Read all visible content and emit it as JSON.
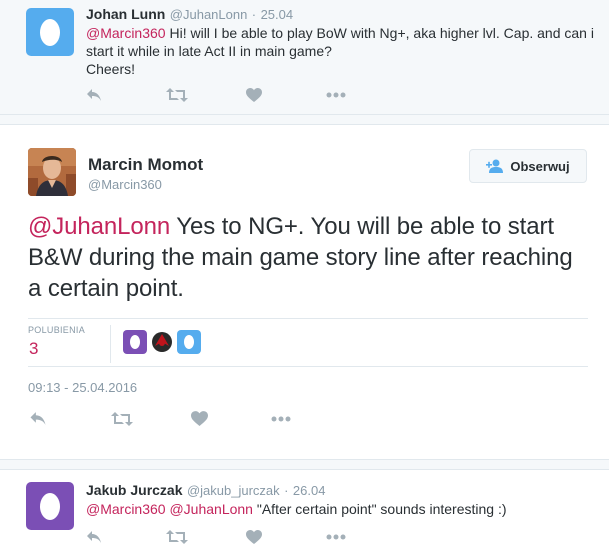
{
  "colors": {
    "accent": "#c4245c",
    "egg_blue": "#55acee",
    "egg_purple": "#7b4fb5",
    "muted": "#8899a6",
    "text": "#292f33"
  },
  "tweets": [
    {
      "name": "Johan Lunn",
      "handle": "@JuhanLonn",
      "separator": "·",
      "date": "25.04",
      "mention": "@Marcin360",
      "body": " Hi! will I be able to play BoW with Ng+, aka higher lvl. Cap. and can i start it while in late Act II in main game?",
      "body2": "Cheers!",
      "avatar_icon": "egg-avatar-icon"
    },
    {
      "name": "Marcin Momot",
      "handle": "@Marcin360",
      "mention": "@JuhanLonn",
      "body": " Yes to NG+. You will be able to start B&W during the main game story line after reaching a certain point.",
      "follow_label": "Obserwuj",
      "likes_label": "POLUBIENIA",
      "likes_count": "3",
      "timestamp": "09:13 - 25.04.2016",
      "avatar_icon": "profile-photo-avatar"
    },
    {
      "name": "Jakub Jurczak",
      "handle": "@jakub_jurczak",
      "separator": "·",
      "date": "26.04",
      "mention1": "@Marcin360",
      "mention2": "@JuhanLonn",
      "body": " \"After certain point\" sounds interesting :)",
      "avatar_icon": "egg-avatar-icon"
    }
  ],
  "action_icons": [
    "reply-icon",
    "retweet-icon",
    "like-icon",
    "more-icon"
  ]
}
